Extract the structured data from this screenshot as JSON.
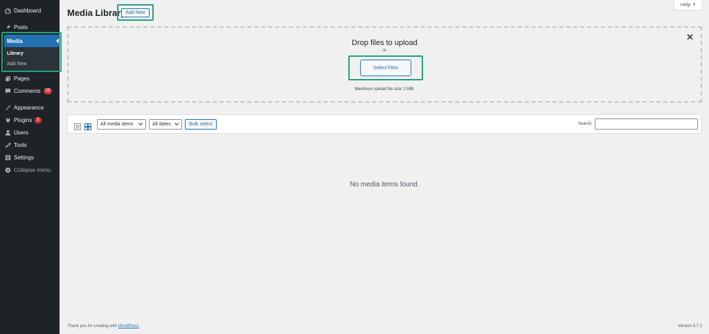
{
  "sidebar": {
    "items": [
      {
        "label": "Dashboard",
        "icon": "dashboard-icon"
      },
      {
        "label": "Posts",
        "icon": "pushpin-icon"
      },
      {
        "label": "Media",
        "icon": "media-icon"
      },
      {
        "label": "Pages",
        "icon": "pages-icon"
      },
      {
        "label": "Comments",
        "icon": "comments-icon",
        "badge": "15"
      },
      {
        "label": "Appearance",
        "icon": "brush-icon"
      },
      {
        "label": "Plugins",
        "icon": "plugin-icon",
        "badge": "2"
      },
      {
        "label": "Users",
        "icon": "user-icon"
      },
      {
        "label": "Tools",
        "icon": "wrench-icon"
      },
      {
        "label": "Settings",
        "icon": "settings-icon"
      },
      {
        "label": "Collapse menu",
        "icon": "collapse-icon"
      }
    ],
    "submenu": [
      "Library",
      "Add New"
    ]
  },
  "header": {
    "title": "Media Library",
    "add_new_label": "Add New",
    "help_label": "Help"
  },
  "uploader": {
    "drop_text": "Drop files to upload",
    "or_text": "or",
    "select_files_label": "Select Files",
    "max_size_text": "Maximum upload file size: 2 MB."
  },
  "toolbar": {
    "type_filter": "All media items",
    "date_filter": "All dates",
    "bulk_select_label": "Bulk select",
    "search_label": "Search",
    "search_value": ""
  },
  "main": {
    "empty_message": "No media items found."
  },
  "footer": {
    "thanks_prefix": "Thank you for creating with",
    "thanks_link": "WordPress",
    "thanks_suffix": ".",
    "version": "Version 5.7.1"
  },
  "colors": {
    "sidebar_bg": "#1d2327",
    "accent": "#2271b1",
    "highlight_border": "#21a17e",
    "badge": "#d63638"
  }
}
